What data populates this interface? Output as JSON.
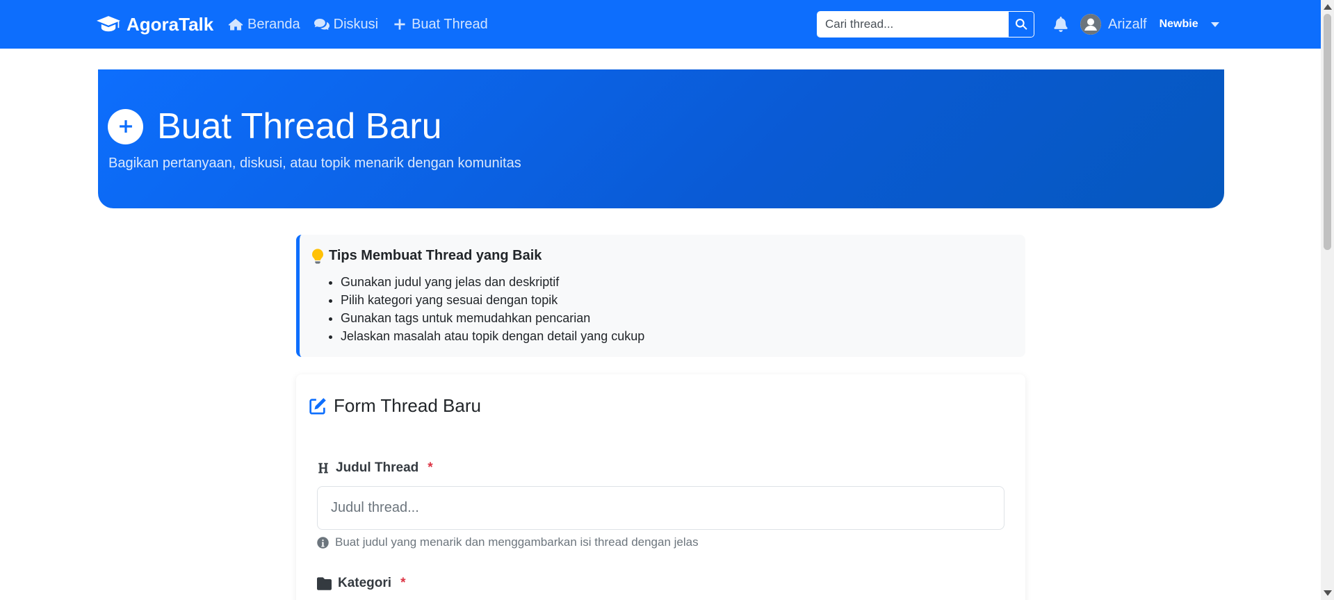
{
  "navbar": {
    "brand": "AgoraTalk",
    "links": [
      {
        "label": "Beranda",
        "icon": "home-icon"
      },
      {
        "label": "Diskusi",
        "icon": "comments-icon"
      },
      {
        "label": "Buat Thread",
        "icon": "plus-icon"
      }
    ],
    "search_placeholder": "Cari thread...",
    "username": "Arizalf",
    "role": "Newbie"
  },
  "hero": {
    "title": "Buat Thread Baru",
    "subtitle": "Bagikan pertanyaan, diskusi, atau topik menarik dengan komunitas"
  },
  "tips": {
    "title": "Tips Membuat Thread yang Baik",
    "items": [
      "Gunakan judul yang jelas dan deskriptif",
      "Pilih kategori yang sesuai dengan topik",
      "Gunakan tags untuk memudahkan pencarian",
      "Jelaskan masalah atau topik dengan detail yang cukup"
    ]
  },
  "form": {
    "title": "Form Thread Baru",
    "judul_label": "Judul Thread",
    "judul_placeholder": "Judul thread...",
    "judul_help": "Buat judul yang menarik dan menggambarkan isi thread dengan jelas",
    "kategori_label": "Kategori",
    "required_mark": "*"
  },
  "colors": {
    "primary": "#0d6efd",
    "required": "#dc3545",
    "tip_icon": "#ffc107"
  }
}
